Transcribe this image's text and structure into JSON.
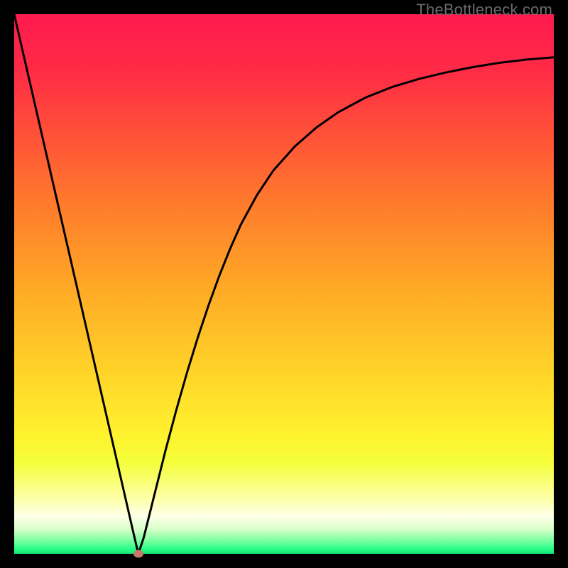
{
  "watermark": "TheBottleneck.com",
  "chart_data": {
    "type": "line",
    "title": "",
    "xlabel": "",
    "ylabel": "",
    "xlim": [
      0,
      100
    ],
    "ylim": [
      0,
      100
    ],
    "grid": false,
    "legend": false,
    "series": [
      {
        "name": "bottleneck-curve",
        "x": [
          0,
          2,
          4,
          6,
          8,
          10,
          12,
          14,
          16,
          18,
          20,
          22,
          23,
          24,
          26,
          28,
          30,
          32,
          34,
          36,
          38,
          40,
          42,
          45,
          48,
          52,
          56,
          60,
          65,
          70,
          75,
          80,
          85,
          90,
          95,
          100
        ],
        "y": [
          100,
          91.3,
          82.6,
          73.9,
          65.2,
          56.5,
          47.8,
          39.1,
          30.4,
          21.7,
          13.0,
          4.3,
          0.0,
          3.0,
          11.0,
          19.0,
          26.5,
          33.5,
          40.0,
          46.0,
          51.5,
          56.5,
          61.0,
          66.5,
          71.0,
          75.5,
          79.0,
          81.8,
          84.5,
          86.5,
          88.0,
          89.2,
          90.2,
          91.0,
          91.6,
          92.0
        ]
      }
    ],
    "marker": {
      "x": 23,
      "y": 0
    },
    "gradient_stops": [
      {
        "offset": 0.0,
        "color": "#ff1a4f"
      },
      {
        "offset": 0.1,
        "color": "#ff2a46"
      },
      {
        "offset": 0.22,
        "color": "#ff5038"
      },
      {
        "offset": 0.35,
        "color": "#ff7a2c"
      },
      {
        "offset": 0.5,
        "color": "#ffa726"
      },
      {
        "offset": 0.65,
        "color": "#ffd028"
      },
      {
        "offset": 0.78,
        "color": "#fff22e"
      },
      {
        "offset": 0.83,
        "color": "#f5ff3a"
      },
      {
        "offset": 0.9,
        "color": "#fdffac"
      },
      {
        "offset": 0.93,
        "color": "#ffffe8"
      },
      {
        "offset": 0.955,
        "color": "#d6ffc8"
      },
      {
        "offset": 0.975,
        "color": "#7dffa0"
      },
      {
        "offset": 0.99,
        "color": "#2dff8a"
      },
      {
        "offset": 1.0,
        "color": "#11e676"
      }
    ]
  }
}
